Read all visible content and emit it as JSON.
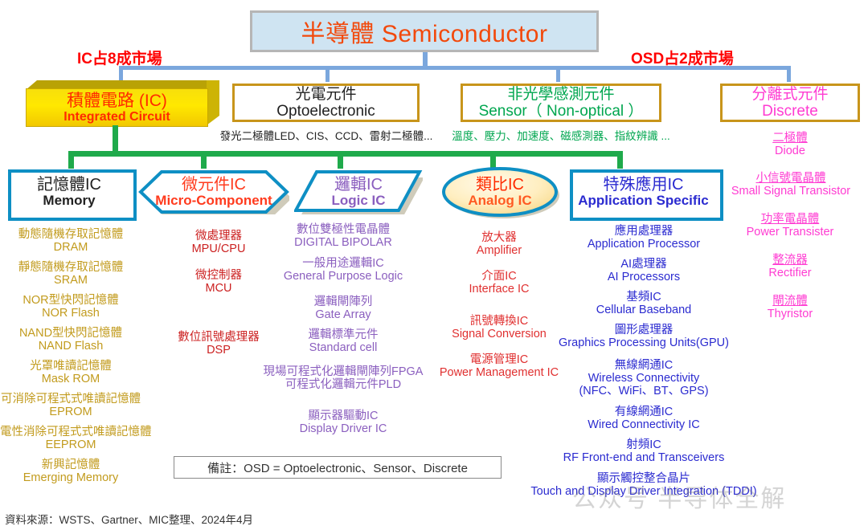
{
  "root": {
    "cn": "半導體",
    "en": "Semiconductor",
    "full": "半導體 Semiconductor"
  },
  "shares": {
    "ic": "IC占8成市場",
    "osd": "OSD占2成市場"
  },
  "level2": [
    {
      "id": "integrated-circuit",
      "cn": "積體電路 (IC)",
      "en": "Integrated Circuit",
      "sub": ""
    },
    {
      "id": "optoelectronic",
      "cn": "光電元件",
      "en": "Optoelectronic",
      "sub": "發光二極體LED、CIS、CCD、雷射二極體..."
    },
    {
      "id": "sensor",
      "cn": "非光學感測元件",
      "en": "Sensor（ Non-optical ）",
      "sub": "溫度、壓力、加速度、磁感測器、指紋辨識 ..."
    },
    {
      "id": "discrete",
      "cn": "分離式元件",
      "en": "Discrete",
      "sub": ""
    }
  ],
  "level3": [
    {
      "id": "memory",
      "cn": "記憶體IC",
      "en": "Memory"
    },
    {
      "id": "micro-component",
      "cn": "微元件IC",
      "en": "Micro-Component"
    },
    {
      "id": "logic-ic",
      "cn": "邏輯IC",
      "en": "Logic IC"
    },
    {
      "id": "analog-ic",
      "cn": "類比IC",
      "en": "Analog IC"
    },
    {
      "id": "application-specific",
      "cn": "特殊應用IC",
      "en": "Application Specific"
    }
  ],
  "columns": {
    "memory": [
      {
        "cn": "動態隨機存取記憶體",
        "en": "DRAM"
      },
      {
        "cn": "靜態隨機存取記憶體",
        "en": "SRAM"
      },
      {
        "cn": "NOR型快閃記憶體",
        "en": "NOR Flash"
      },
      {
        "cn": "NAND型快閃記憶體",
        "en": "NAND Flash"
      },
      {
        "cn": "光罩唯讀記憶體",
        "en": "Mask ROM"
      },
      {
        "cn": "可消除可程式式唯讀記憶體",
        "en": "EPROM"
      },
      {
        "cn": "電性消除可程式式唯讀記憶體",
        "en": "EEPROM"
      },
      {
        "cn": "新興記憶體",
        "en": "Emerging Memory"
      }
    ],
    "micro_component": [
      {
        "cn": "微處理器",
        "en": "MPU/CPU"
      },
      {
        "cn": "微控制器",
        "en": "MCU"
      },
      {
        "cn": "數位訊號處理器",
        "en": "DSP"
      }
    ],
    "logic_ic": [
      {
        "cn": "數位雙極性電晶體",
        "en": "DIGITAL BIPOLAR"
      },
      {
        "cn": "一般用途邏輯IC",
        "en": "General Purpose Logic"
      },
      {
        "cn": "邏輯閘陣列",
        "en": "Gate Array"
      },
      {
        "cn": "邏輯標準元件",
        "en": "Standard cell"
      },
      {
        "cn": "現場可程式化邏輯閘陣列FPGA",
        "en": "可程式化邏輯元件PLD"
      },
      {
        "cn": "顯示器驅動IC",
        "en": "Display Driver IC"
      }
    ],
    "analog_ic": [
      {
        "cn": "放大器",
        "en": "Amplifier"
      },
      {
        "cn": "介面IC",
        "en": "Interface IC"
      },
      {
        "cn": "訊號轉換IC",
        "en": "Signal Conversion"
      },
      {
        "cn": "電源管理IC",
        "en": "Power Management IC"
      }
    ],
    "application_specific": [
      {
        "cn": "應用處理器",
        "en": "Application Processor"
      },
      {
        "cn": "AI處理器",
        "en": "AI Processors"
      },
      {
        "cn": "基頻IC",
        "en": "Cellular Baseband"
      },
      {
        "cn": "圖形處理器",
        "en": "Graphics Processing Units(GPU)"
      },
      {
        "cn": "無線網通IC",
        "en": "Wireless Connectivity",
        "en2": "(NFC、WiFi、BT、GPS)"
      },
      {
        "cn": "有線網通IC",
        "en": "Wired Connectivity IC"
      },
      {
        "cn": "射頻IC",
        "en": "RF Front-end and Transceivers"
      },
      {
        "cn": "顯示觸控整合晶片",
        "en": "Touch and Display Driver Integration (TDDI)"
      }
    ],
    "discrete": [
      {
        "cn": "二極體",
        "en": "Diode"
      },
      {
        "cn": "小信號電晶體",
        "en": "Small Signal Transistor"
      },
      {
        "cn": "功率電晶體",
        "en": "Power Transister"
      },
      {
        "cn": "整流器",
        "en": "Rectifier"
      },
      {
        "cn": "閘流體",
        "en": "Thyristor"
      }
    ]
  },
  "note": "備註：OSD = Optoelectronic、Sensor、Discrete",
  "source": "資料來源：WSTS、Gartner、MIC整理、2024年4月",
  "watermark": "公众号 半导体全解",
  "colors": {
    "root_bg": "#cfe4f2",
    "root_text": "#f2490c",
    "share_text": "#ff0000",
    "blue_line": "#7ba7dd",
    "green_line": "#1faa4b",
    "gold_border": "#c8951b",
    "memory": "#c29b1d",
    "micro": "#cc2222",
    "logic": "#8b5fbf",
    "analog": "#e03030",
    "application": "#2b2bd0",
    "discrete": "#ff3bd2",
    "ic_yellow": "#ffe800",
    "shape_blue": "#0e8fc4"
  }
}
